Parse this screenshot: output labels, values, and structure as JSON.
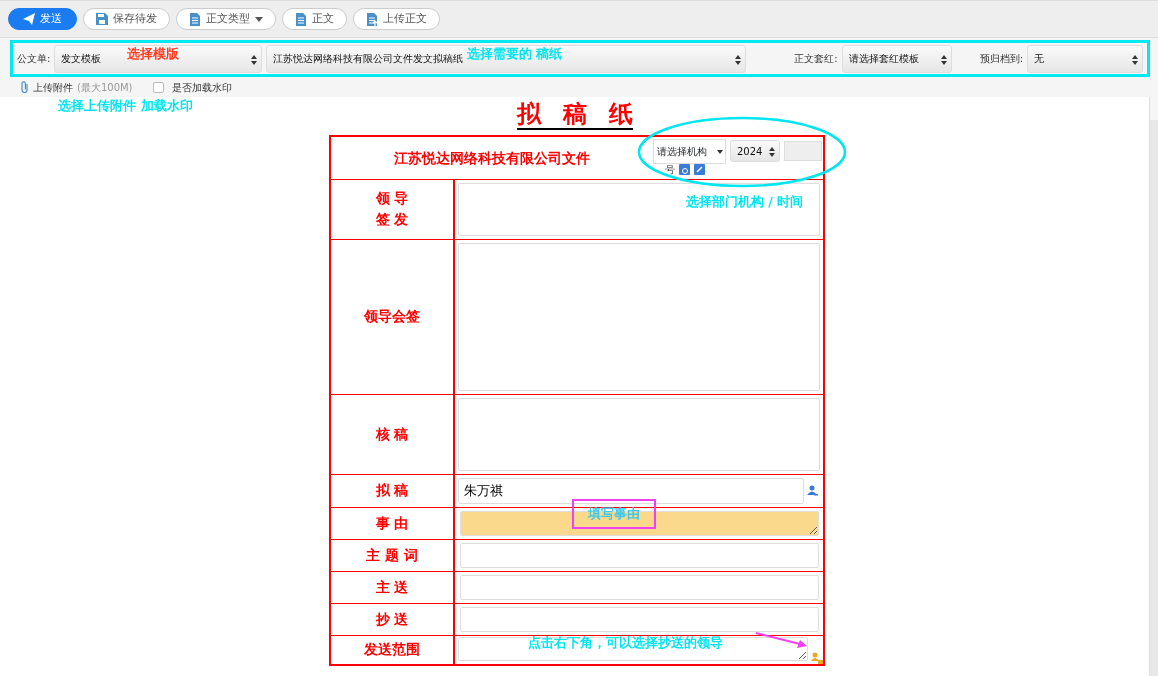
{
  "toolbar": [
    {
      "label": "发送",
      "kind": "primary"
    },
    {
      "label": "保存待发",
      "kind": "plain"
    },
    {
      "label": "正文类型",
      "kind": "dropdown"
    },
    {
      "label": "正文",
      "kind": "plain"
    },
    {
      "label": "上传正文",
      "kind": "plain"
    }
  ],
  "template_bar": {
    "label": "公文单:",
    "template_select": "发文模板",
    "paper_select": "江苏悦达网络科技有限公司文件发文拟稿纸",
    "redhead_label": "正文套红:",
    "redhead_select": "请选择套红模板",
    "archive_label": "预归档到:",
    "archive_select": "无"
  },
  "attachments": {
    "upload_label": "上传附件",
    "upload_hint": "(最大100M)",
    "watermark": {
      "label": "是否加载水印",
      "checked": false
    }
  },
  "title": "拟 稿 纸",
  "form": {
    "company": "江苏悦达网络科技有限公司文件",
    "org_select": "请选择机构",
    "year_select": "2024",
    "number_suffix": "号",
    "rows": [
      {
        "label_lines": [
          "领 导",
          "签 发"
        ],
        "kind": "area",
        "value": ""
      },
      {
        "label_lines": [
          "领导会签"
        ],
        "kind": "area",
        "value": ""
      },
      {
        "label_lines": [
          "核 稿"
        ],
        "kind": "area",
        "value": ""
      },
      {
        "label_lines": [
          "拟 稿"
        ],
        "kind": "person",
        "value": "朱万祺"
      },
      {
        "label_lines": [
          "事 由"
        ],
        "kind": "reason",
        "value": ""
      },
      {
        "label_lines": [
          "主 题 词"
        ],
        "kind": "line",
        "value": ""
      },
      {
        "label_lines": [
          "主 送"
        ],
        "kind": "line",
        "value": ""
      },
      {
        "label_lines": [
          "抄 送"
        ],
        "kind": "line",
        "value": ""
      },
      {
        "label_lines": [
          "发送范围"
        ],
        "kind": "scope",
        "value": ""
      }
    ]
  },
  "annotations": [
    {
      "text": "选择模版",
      "kind": "red"
    },
    {
      "text": "选择需要的 稿纸",
      "kind": "cyan"
    },
    {
      "text": "选择上传附件",
      "kind": "cyan"
    },
    {
      "text": "加载水印",
      "kind": "cyan"
    },
    {
      "text": "选择部门机构 / 时间",
      "kind": "cyan"
    },
    {
      "text": "填写事由",
      "kind": "boxed"
    },
    {
      "text": "点击右下角，可以选择抄送的领导",
      "kind": "cyan"
    }
  ]
}
